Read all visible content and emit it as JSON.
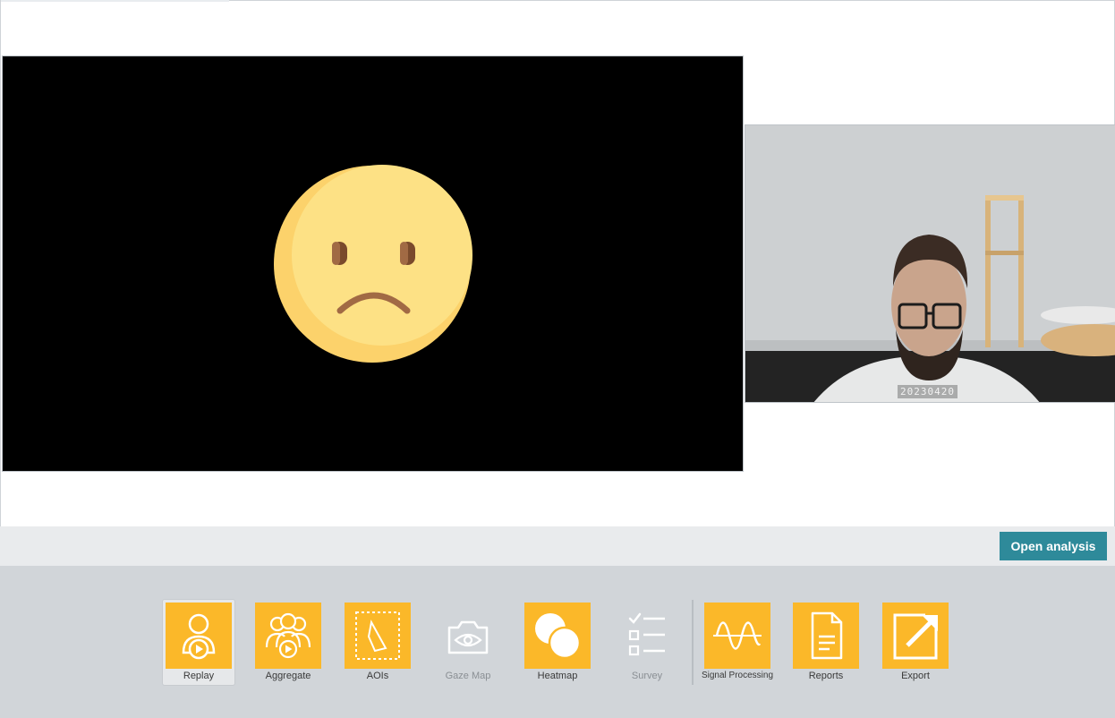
{
  "webcam": {
    "timestamp": "20230420"
  },
  "analysis": {
    "open_label": "Open analysis"
  },
  "colors": {
    "tile": "#fbb829",
    "accent_button": "#2e8a9a",
    "toolbar_bg": "#d1d5d9"
  },
  "toolbar": {
    "items": [
      {
        "label": "Replay",
        "icon": "person-play-icon",
        "state": "active"
      },
      {
        "label": "Aggregate",
        "icon": "group-play-icon",
        "state": "enabled"
      },
      {
        "label": "AOIs",
        "icon": "aoi-polygon-icon",
        "state": "enabled"
      },
      {
        "label": "Gaze Map",
        "icon": "camera-eye-icon",
        "state": "disabled"
      },
      {
        "label": "Heatmap",
        "icon": "heatmap-circles-icon",
        "state": "enabled"
      },
      {
        "label": "Survey",
        "icon": "checklist-icon",
        "state": "disabled"
      },
      {
        "label": "Signal Processing",
        "icon": "sine-wave-icon",
        "state": "enabled"
      },
      {
        "label": "Reports",
        "icon": "document-icon",
        "state": "enabled"
      },
      {
        "label": "Export",
        "icon": "export-arrow-icon",
        "state": "enabled"
      }
    ]
  }
}
